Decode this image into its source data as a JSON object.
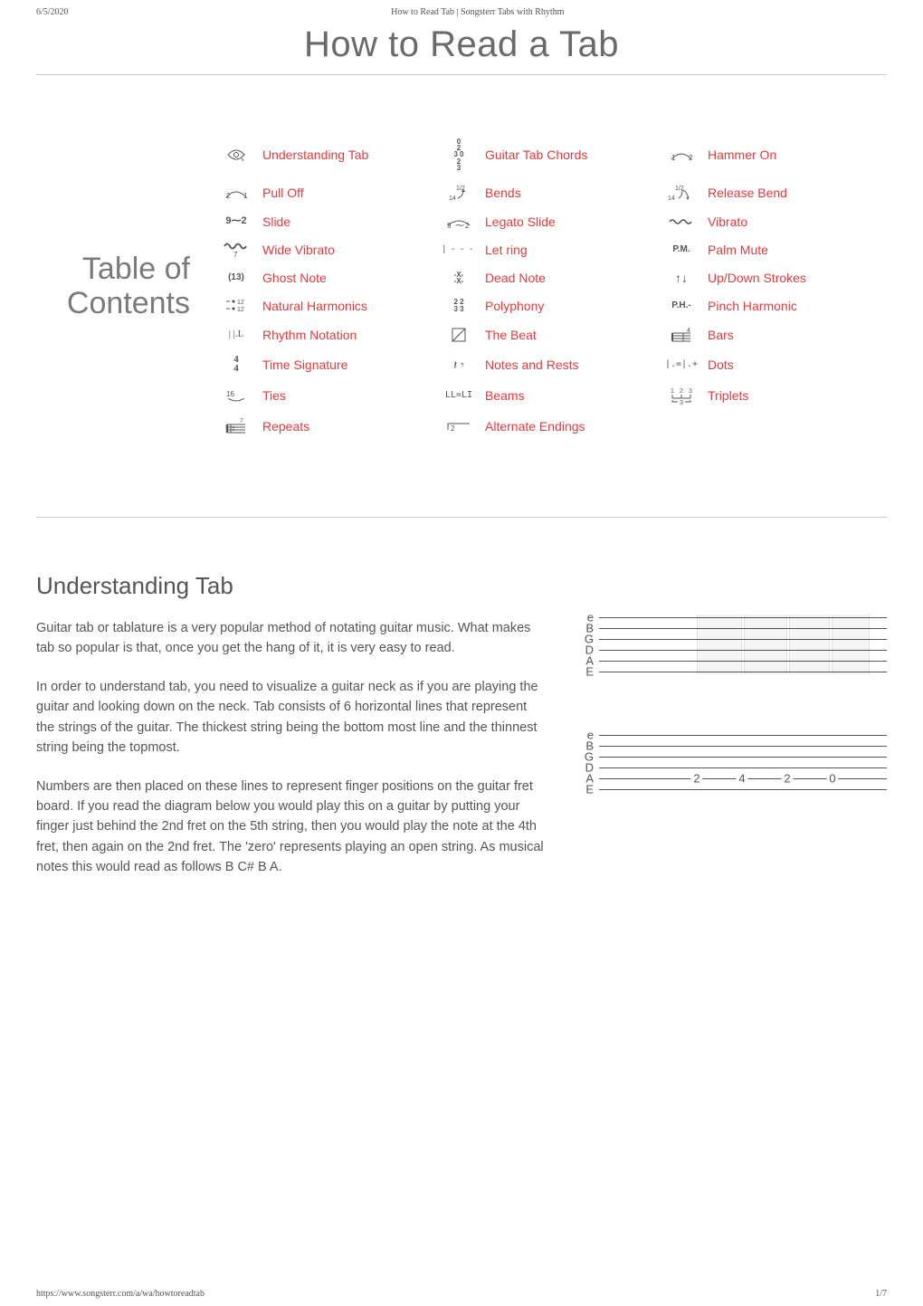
{
  "meta": {
    "date": "6/5/2020",
    "header_title": "How to Read Tab | Songsterr Tabs with Rhythm",
    "footer_url": "https://www.songsterr.com/a/wa/howtoreadtab",
    "footer_page": "1/7"
  },
  "title": "How to Read a Tab",
  "toc": {
    "label_line1": "Table of",
    "label_line2": "Contents",
    "items": [
      {
        "label": "Understanding Tab",
        "icon": "eye"
      },
      {
        "label": "Guitar Tab Chords",
        "icon": "chords"
      },
      {
        "label": "Hammer On",
        "icon": "hammer"
      },
      {
        "label": "Pull Off",
        "icon": "pulloff"
      },
      {
        "label": "Bends",
        "icon": "bend"
      },
      {
        "label": "Release Bend",
        "icon": "release"
      },
      {
        "label": "Slide",
        "icon": "slide"
      },
      {
        "label": "Legato Slide",
        "icon": "legato"
      },
      {
        "label": "Vibrato",
        "icon": "vibrato"
      },
      {
        "label": "Wide Vibrato",
        "icon": "widevib"
      },
      {
        "label": "Let ring",
        "icon": "letring"
      },
      {
        "label": "Palm Mute",
        "icon": "pm"
      },
      {
        "label": "Ghost Note",
        "icon": "ghost"
      },
      {
        "label": "Dead Note",
        "icon": "dead"
      },
      {
        "label": "Up/Down Strokes",
        "icon": "updown"
      },
      {
        "label": "Natural Harmonics",
        "icon": "nathm"
      },
      {
        "label": "Polyphony",
        "icon": "poly"
      },
      {
        "label": "Pinch Harmonic",
        "icon": "pinch"
      },
      {
        "label": "Rhythm Notation",
        "icon": "rhythm"
      },
      {
        "label": "The Beat",
        "icon": "beat"
      },
      {
        "label": "Bars",
        "icon": "bars"
      },
      {
        "label": "Time Signature",
        "icon": "timesig"
      },
      {
        "label": "Notes and Rests",
        "icon": "rests"
      },
      {
        "label": "Dots",
        "icon": "dots"
      },
      {
        "label": "Ties",
        "icon": "ties"
      },
      {
        "label": "Beams",
        "icon": "beams"
      },
      {
        "label": "Triplets",
        "icon": "triplets"
      },
      {
        "label": "Repeats",
        "icon": "repeats"
      },
      {
        "label": "Alternate Endings",
        "icon": "altend"
      }
    ]
  },
  "icons": {
    "chords": "0\n2\n3 0\n2\n3",
    "hammer": "1   2",
    "pulloff": "2   1",
    "bend": "1/2\n14",
    "release": "1/2\n14",
    "slide": "9⁓2",
    "legato": "9⁓2",
    "vibrato": "∿∿",
    "widevib": "∿∿\n7",
    "letring": "| - - -",
    "pm": "P.M.",
    "ghost": "(13)",
    "dead": "-X-\n-X-",
    "updown": "↑↓",
    "nathm": "◆12\n◆12",
    "poly": "2 2\n3 3",
    "pinch": "P.H.-",
    "rhythm": "| |.L",
    "timesig": "4\n4",
    "rests": "𝄽 𝄾",
    "dots": "|.=|.+",
    "ties": "16",
    "beams": "LL=LI",
    "triplets": "1 2 3\n⌊3⌋",
    "repeats": "7",
    "altend": "⌐2⎯",
    "bars": "4"
  },
  "section": {
    "heading": "Understanding Tab",
    "p1": "Guitar tab or tablature is a very popular method of notating guitar music. What makes tab so popular is that, once you get the hang of it, it is very easy to read.",
    "p2": "In order to understand tab, you need to visualize a guitar neck as if you are playing the guitar and looking down on the neck. Tab consists of 6 horizontal lines that represent the strings of the guitar. The thickest string being the bottom most line and the thinnest string being the topmost.",
    "p3": "Numbers are then placed on these lines to represent finger positions on the guitar fret board. If you read the diagram below you would play this on a guitar by putting your finger just behind the 2nd fret on the 5th string, then you would play the note at the 4th fret, then again on the 2nd fret. The 'zero' represents playing an open string. As musical notes this would read as follows B C# B A."
  },
  "diagram": {
    "strings": [
      "e",
      "B",
      "G",
      "D",
      "A",
      "E"
    ],
    "frets": [
      "2",
      "4",
      "2",
      "0"
    ]
  }
}
